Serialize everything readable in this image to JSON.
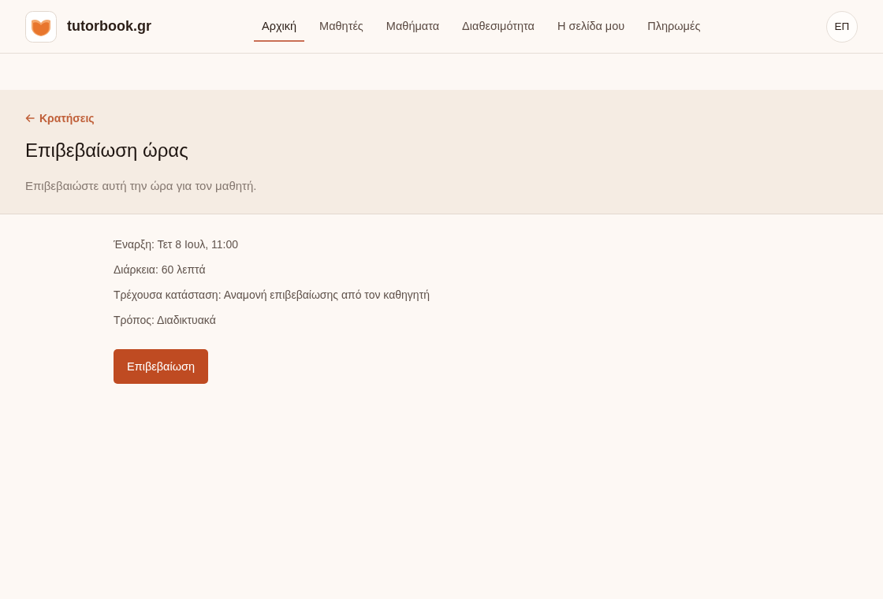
{
  "header": {
    "brand": "tutorbook.gr",
    "nav": [
      {
        "label": "Αρχική",
        "selected": true
      },
      {
        "label": "Μαθητές",
        "selected": false
      },
      {
        "label": "Μαθήματα",
        "selected": false
      },
      {
        "label": "Διαθεσιμότητα",
        "selected": false
      },
      {
        "label": "Η σελίδα μου",
        "selected": false
      },
      {
        "label": "Πληρωμές",
        "selected": false
      }
    ],
    "avatar": "ΕΠ"
  },
  "page_header": {
    "back_link": "Κρατήσεις",
    "title": "Επιβεβαίωση ώρας",
    "subtitle": "Επιβεβαιώστε αυτή την ώρα για τον μαθητή."
  },
  "details": [
    "Έναρξη: Τετ 8 Ιουλ, 11:00",
    "Διάρκεια: 60 λεπτά",
    "Τρέχουσα κατάσταση: Αναμονή επιβεβαίωσης από τον καθηγητή",
    "Τρόπος: Διαδικτυακά"
  ],
  "confirm_button": "Επιβεβαίωση"
}
